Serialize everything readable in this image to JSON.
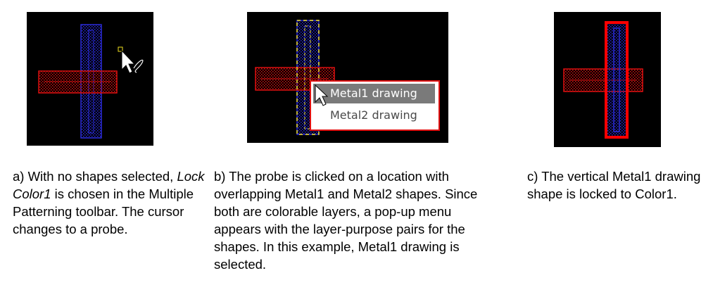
{
  "panel_a": {
    "caption_start": "a) With no shapes selected, ",
    "caption_emphasis": "Lock Color1",
    "caption_end": " is chosen in the Multiple Patterning toolbar. The cursor changes to a probe."
  },
  "panel_b": {
    "popup_menu": {
      "items": [
        "Metal1 drawing",
        "Metal2 drawing"
      ],
      "selected": "Metal1 drawing"
    },
    "caption": "b) The probe is clicked on a location with overlapping Metal1 and Metal2 shapes. Since both are colorable layers, a pop-up menu appears with the layer-purpose pairs for the shapes. In this example, Metal1 drawing is selected."
  },
  "panel_c": {
    "caption": "c) The vertical Metal1 drawing shape is locked to Color1."
  },
  "colors": {
    "canvas_background": "#000000",
    "metal1": "#e01010",
    "metal2": "#2020d0",
    "selection_highlight": "#f0e020",
    "locked_color1": "#ff0000"
  }
}
